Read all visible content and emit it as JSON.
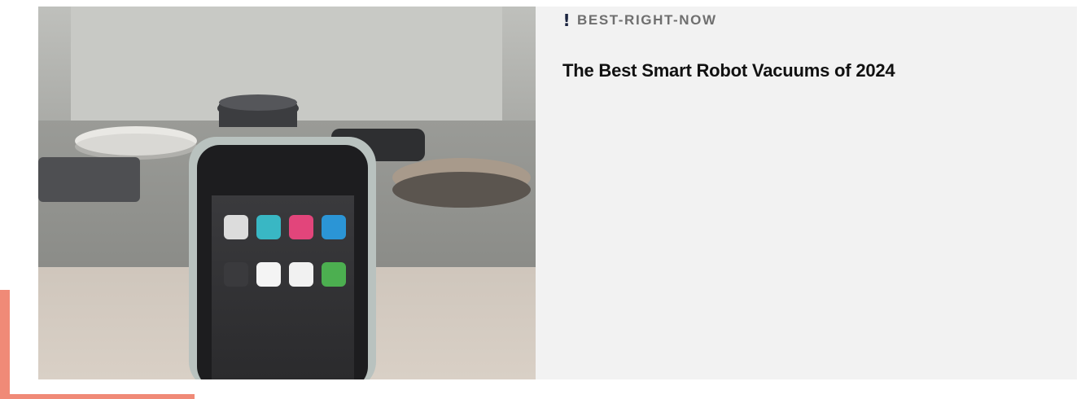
{
  "article": {
    "category": "BEST-RIGHT-NOW",
    "title": "The Best Smart Robot Vacuums of 2024"
  },
  "icons": {
    "category_marker": "exclamation-icon"
  },
  "colors": {
    "accent": "#f08a77",
    "card_background": "#f2f2f2",
    "category_text": "#6f6f6f",
    "marker": "#1b2440",
    "headline": "#111111"
  }
}
